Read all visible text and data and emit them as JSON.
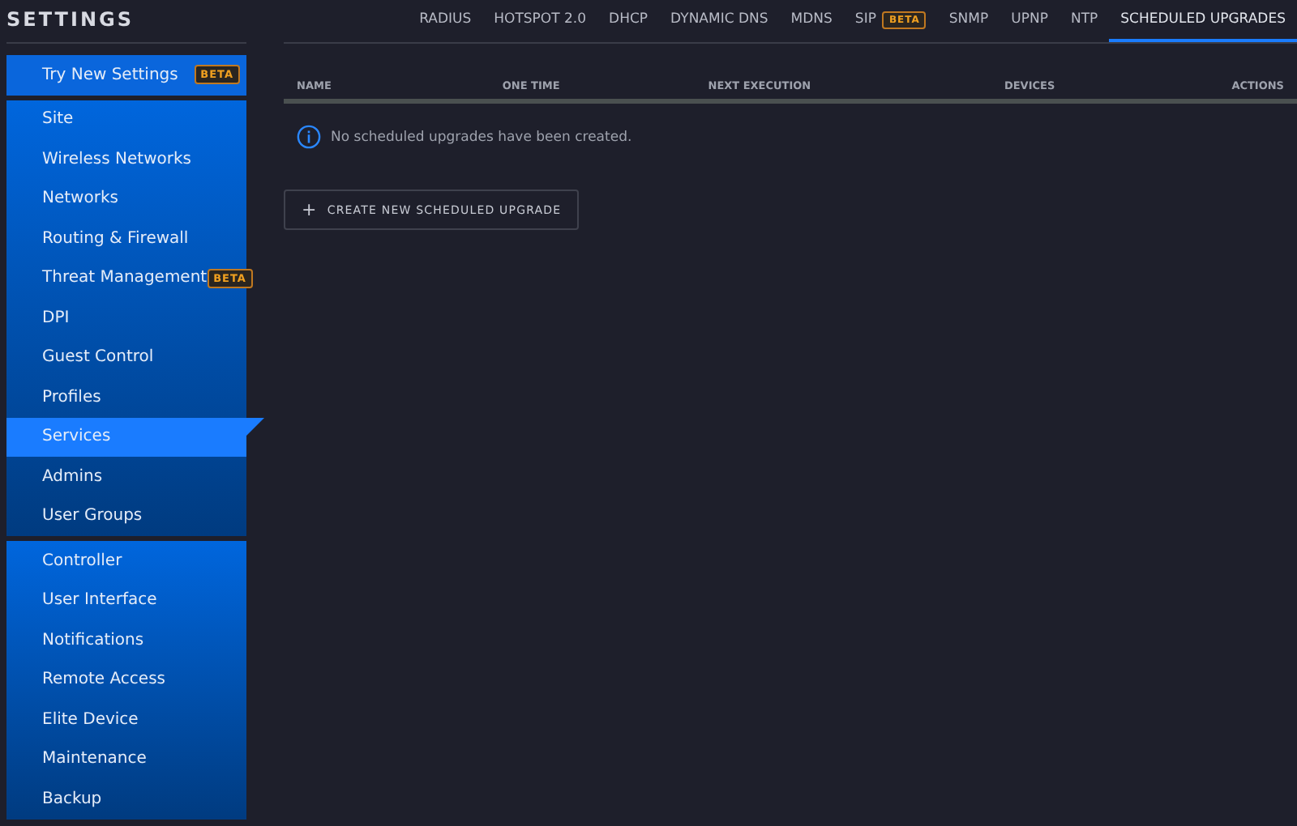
{
  "sidebar": {
    "title": "SETTINGS",
    "groups": [
      {
        "items": [
          {
            "label": "Try New Settings",
            "badge": "BETA",
            "selected": false
          }
        ]
      },
      {
        "items": [
          {
            "label": "Site",
            "selected": false
          },
          {
            "label": "Wireless Networks",
            "selected": false
          },
          {
            "label": "Networks",
            "selected": false
          },
          {
            "label": "Routing & Firewall",
            "selected": false
          },
          {
            "label": "Threat Management",
            "badge": "BETA",
            "selected": false
          },
          {
            "label": "DPI",
            "selected": false
          },
          {
            "label": "Guest Control",
            "selected": false
          },
          {
            "label": "Profiles",
            "selected": false
          },
          {
            "label": "Services",
            "selected": true
          },
          {
            "label": "Admins",
            "selected": false
          },
          {
            "label": "User Groups",
            "selected": false
          }
        ]
      },
      {
        "items": [
          {
            "label": "Controller",
            "selected": false
          },
          {
            "label": "User Interface",
            "selected": false
          },
          {
            "label": "Notifications",
            "selected": false
          },
          {
            "label": "Remote Access",
            "selected": false
          },
          {
            "label": "Elite Device",
            "selected": false
          },
          {
            "label": "Maintenance",
            "selected": false
          },
          {
            "label": "Backup",
            "selected": false
          }
        ]
      }
    ]
  },
  "tabs": [
    {
      "label": "RADIUS",
      "selected": false
    },
    {
      "label": "HOTSPOT 2.0",
      "selected": false
    },
    {
      "label": "DHCP",
      "selected": false
    },
    {
      "label": "DYNAMIC DNS",
      "selected": false
    },
    {
      "label": "MDNS",
      "selected": false
    },
    {
      "label": "SIP",
      "badge": "BETA",
      "selected": false
    },
    {
      "label": "SNMP",
      "selected": false
    },
    {
      "label": "UPNP",
      "selected": false
    },
    {
      "label": "NTP",
      "selected": false
    },
    {
      "label": "SCHEDULED UPGRADES",
      "selected": true
    }
  ],
  "table": {
    "columns": [
      "NAME",
      "ONE TIME",
      "NEXT EXECUTION",
      "DEVICES",
      "ACTIONS"
    ],
    "empty_message": "No scheduled upgrades have been created."
  },
  "create_button": {
    "icon": "+",
    "label": "CREATE NEW SCHEDULED UPGRADE"
  }
}
